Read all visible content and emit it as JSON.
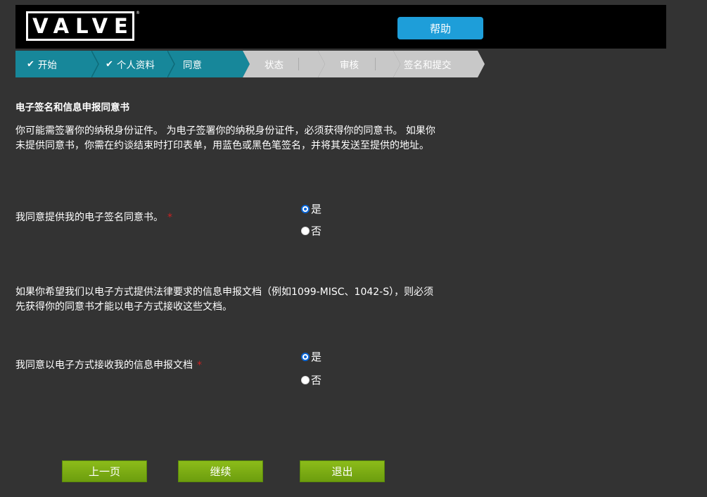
{
  "header": {
    "logo_text": "VALVE",
    "logo_tm": "®",
    "help_label": "帮助"
  },
  "steps": [
    {
      "label": "开始",
      "done": true,
      "active": true,
      "check": "✔"
    },
    {
      "label": "个人资料",
      "done": true,
      "active": true,
      "check": "✔"
    },
    {
      "label": "同意",
      "done": false,
      "active": true
    },
    {
      "label": "状态",
      "done": false,
      "active": false
    },
    {
      "label": "审核",
      "done": false,
      "active": false
    },
    {
      "label": "签名和提交",
      "done": false,
      "active": false
    }
  ],
  "colors": {
    "active_step": "#17879a",
    "inactive_step": "#c8c8c8",
    "button_green": "#7aab14",
    "help_blue": "#1e9ed9",
    "required": "#cc2222",
    "background": "#333333"
  },
  "content": {
    "title": "电子签名和信息申报同意书",
    "intro_line1": "你可能需签署你的纳税身份证件。 为电子签署你的纳税身份证件，必须获得你的同意书。 如果你",
    "intro_line2": "未提供同意书，你需在约谈结束时打印表单，用蓝色或黑色笔签名，并将其发送至提供的地址。",
    "q1_label": "我同意提供我的电子签名同意书。",
    "q1_required": "*",
    "q1_yes": "是",
    "q1_no": "否",
    "q1_value": "是",
    "info_line1": "如果你希望我们以电子方式提供法律要求的信息申报文档（例如1099-MISC、1042-S），则必须",
    "info_line2": "先获得你的同意书才能以电子方式接收这些文档。",
    "q2_label": "我同意以电子方式接收我的信息申报文档",
    "q2_required": "*",
    "q2_yes": "是",
    "q2_no": "否",
    "q2_value": "是"
  },
  "buttons": {
    "prev": "上一页",
    "continue": "继续",
    "exit": "退出"
  }
}
